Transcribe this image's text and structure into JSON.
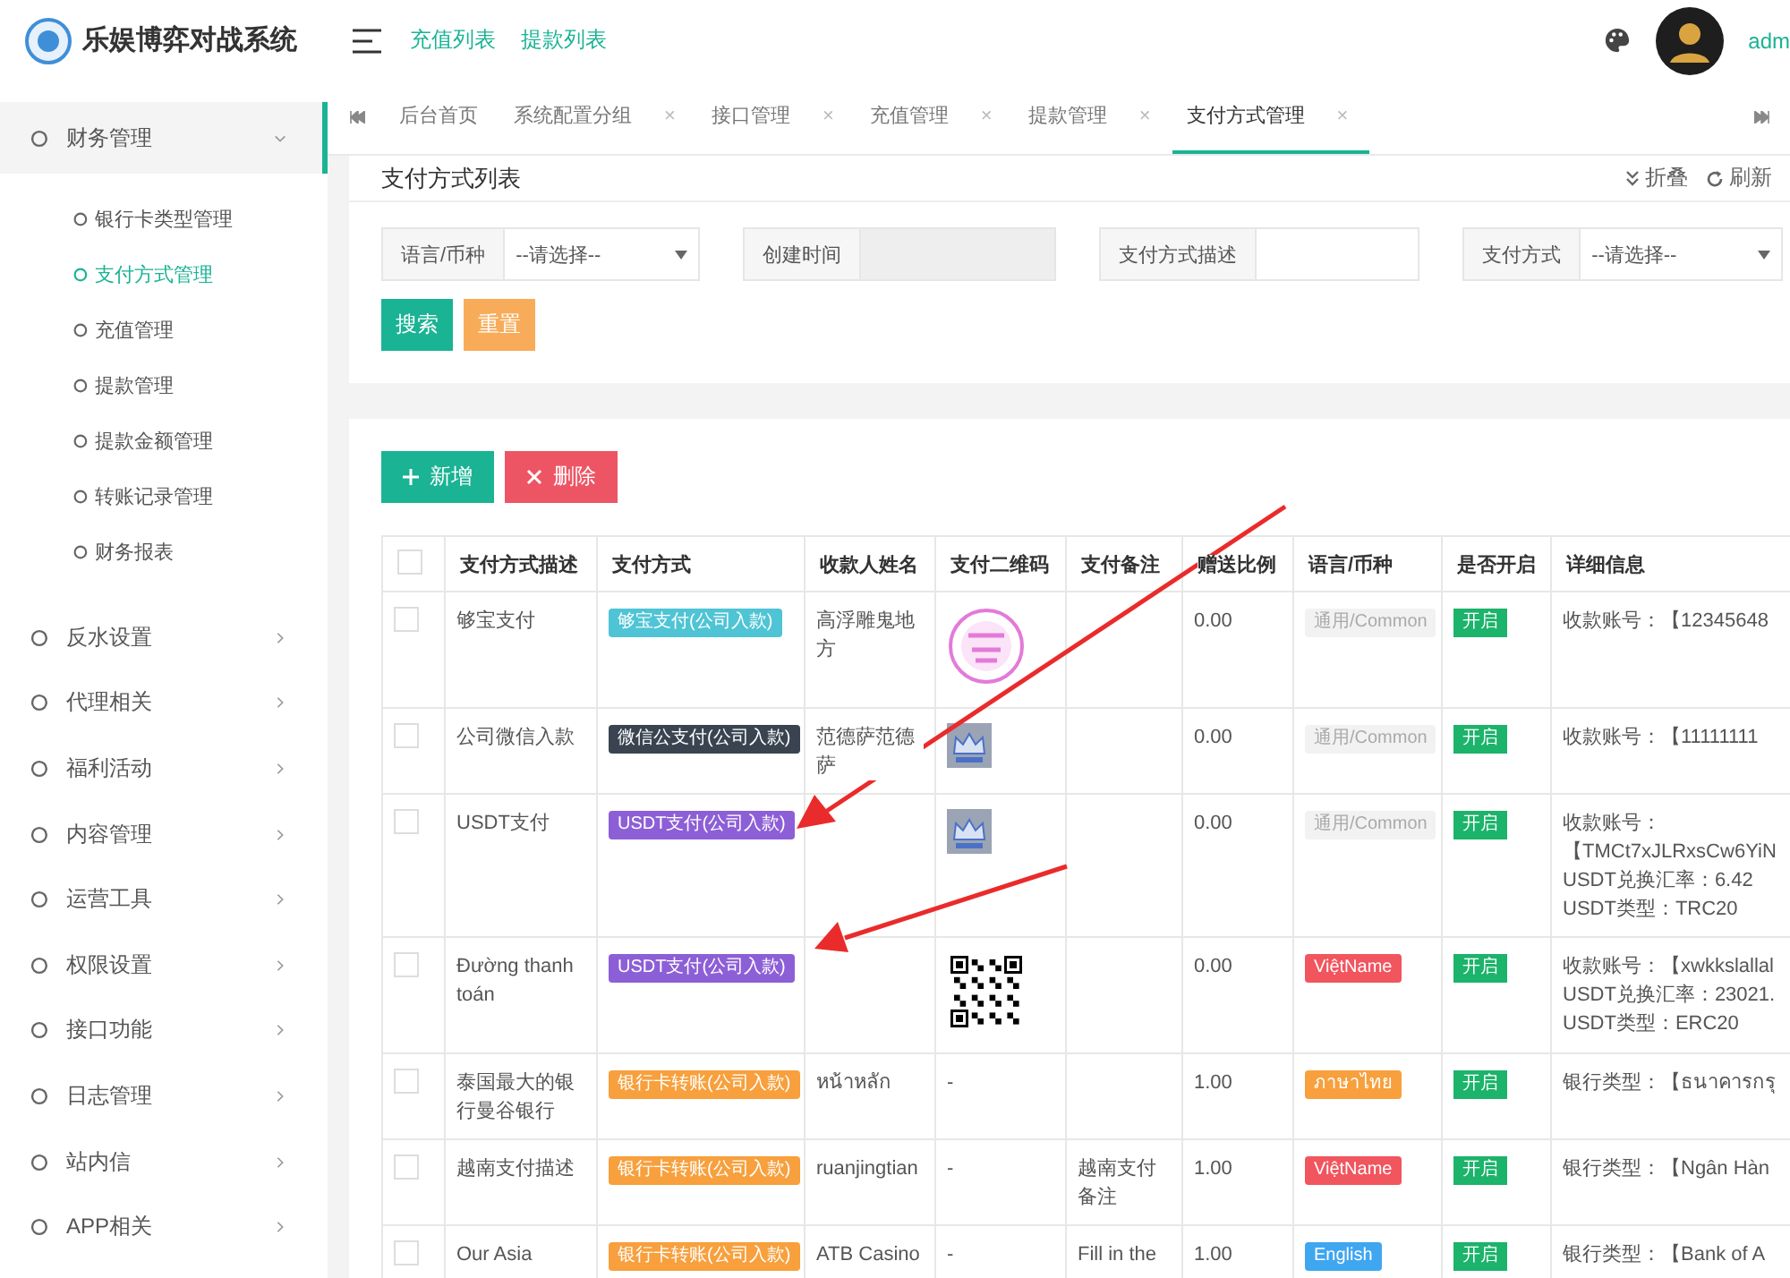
{
  "brand": {
    "title": "乐娱博弈对战系统"
  },
  "header": {
    "links": [
      "充值列表",
      "提款列表"
    ],
    "user": "adm"
  },
  "sidebar": {
    "items": [
      {
        "label": "财务管理",
        "expanded": true,
        "children": [
          {
            "label": "银行卡类型管理",
            "selected": false
          },
          {
            "label": "支付方式管理",
            "selected": true
          },
          {
            "label": "充值管理",
            "selected": false
          },
          {
            "label": "提款管理",
            "selected": false
          },
          {
            "label": "提款金额管理",
            "selected": false
          },
          {
            "label": "转账记录管理",
            "selected": false
          },
          {
            "label": "财务报表",
            "selected": false
          }
        ]
      },
      {
        "label": "反水设置",
        "expanded": false
      },
      {
        "label": "代理相关",
        "expanded": false
      },
      {
        "label": "福利活动",
        "expanded": false
      },
      {
        "label": "内容管理",
        "expanded": false
      },
      {
        "label": "运营工具",
        "expanded": false
      },
      {
        "label": "权限设置",
        "expanded": false
      },
      {
        "label": "接口功能",
        "expanded": false
      },
      {
        "label": "日志管理",
        "expanded": false
      },
      {
        "label": "站内信",
        "expanded": false
      },
      {
        "label": "APP相关",
        "expanded": false
      }
    ]
  },
  "tabs": [
    {
      "label": "后台首页",
      "selected": false
    },
    {
      "label": "系统配置分组",
      "close": "×",
      "selected": false
    },
    {
      "label": "接口管理",
      "close": "×",
      "selected": false
    },
    {
      "label": "充值管理",
      "close": "×",
      "selected": false
    },
    {
      "label": "提款管理",
      "close": "×",
      "selected": false
    },
    {
      "label": "支付方式管理",
      "close": "×",
      "selected": true
    }
  ],
  "panel": {
    "title": "支付方式列表",
    "actions": [
      "折叠",
      "刷新"
    ]
  },
  "filters": [
    {
      "label": "语言/币种",
      "kind": "select",
      "value": "--请选择--"
    },
    {
      "label": "创建时间",
      "kind": "disabled"
    },
    {
      "label": "支付方式描述",
      "kind": "input"
    },
    {
      "label": "支付方式",
      "kind": "select",
      "value": "--请选择--"
    }
  ],
  "filter_buttons": [
    "搜索",
    "重置"
  ],
  "toolbar": [
    "新增",
    "删除"
  ],
  "table": {
    "select_all": {
      "checked": false
    },
    "columns": [
      "支付方式描述",
      "支付方式",
      "收款人姓名",
      "支付二维码",
      "支付备注",
      "赠送比例",
      "语言/币种",
      "是否开启",
      "详细信息"
    ],
    "rows": [
      {
        "checked": false,
        "description": "够宝支付",
        "method": {
          "text": "够宝支付(公司入款)",
          "color": "#4fc4d4"
        },
        "payee": "高浮雕鬼地方",
        "qr": {
          "kind": "stamp"
        },
        "note": "",
        "ratio": "0.00",
        "language": {
          "text": "通用/Common",
          "color": "#f2f2f2"
        },
        "status": {
          "text": "开启",
          "on": true
        },
        "details": [
          "收款账号：【12345648"
        ]
      },
      {
        "checked": false,
        "description": "公司微信入款",
        "method": {
          "text": "微信公支付(公司入款)",
          "color": "#3a4451"
        },
        "payee": "范德萨范德萨",
        "qr": {
          "kind": "crown"
        },
        "note": "",
        "ratio": "0.00",
        "language": {
          "text": "通用/Common",
          "color": "#f2f2f2"
        },
        "status": {
          "text": "开启",
          "on": true
        },
        "details": [
          "收款账号：【11111111"
        ]
      },
      {
        "checked": false,
        "description": "USDT支付",
        "method": {
          "text": "USDT支付(公司入款)",
          "color": "#8d5fd6"
        },
        "payee": "",
        "qr": {
          "kind": "crown"
        },
        "note": "",
        "ratio": "0.00",
        "language": {
          "text": "通用/Common",
          "color": "#f2f2f2"
        },
        "status": {
          "text": "开启",
          "on": true
        },
        "details": [
          "收款账号：",
          "【TMCt7xJLRxsCw6YiN",
          "USDT兑换汇率：6.42",
          "USDT类型：TRC20"
        ]
      },
      {
        "checked": false,
        "description": "Đường thanh toán",
        "method": {
          "text": "USDT支付(公司入款)",
          "color": "#8d5fd6"
        },
        "payee": "",
        "qr": {
          "kind": "qrcode"
        },
        "note": "",
        "ratio": "0.00",
        "language": {
          "text": "ViệtName",
          "color": "#f1555e"
        },
        "status": {
          "text": "开启",
          "on": true
        },
        "details": [
          "收款账号：【xwkkslallal",
          "USDT兑换汇率：23021.",
          "USDT类型：ERC20"
        ]
      },
      {
        "checked": false,
        "description": "泰国最大的银行曼谷银行",
        "method": {
          "text": "银行卡转账(公司入款)",
          "color": "#f7a03d"
        },
        "payee": "หน้าหลัก",
        "qr": {
          "kind": "text",
          "text": "-"
        },
        "note": "",
        "ratio": "1.00",
        "language": {
          "text": "ภาษาไทย",
          "color": "#f7a03d"
        },
        "status": {
          "text": "开启",
          "on": true
        },
        "details": [
          "银行类型：【ธนาคารกรุ"
        ]
      },
      {
        "checked": false,
        "description": "越南支付描述",
        "method": {
          "text": "银行卡转账(公司入款)",
          "color": "#f7a03d"
        },
        "payee": "ruanjingtian",
        "qr": {
          "kind": "text",
          "text": "-"
        },
        "note": "越南支付备注",
        "ratio": "1.00",
        "language": {
          "text": "ViệtName",
          "color": "#f1555e"
        },
        "status": {
          "text": "开启",
          "on": true
        },
        "details": [
          "银行类型：【Ngân Hàn"
        ]
      },
      {
        "checked": false,
        "description": "Our Asia",
        "method": {
          "text": "银行卡转账(公司入款)",
          "color": "#f7a03d"
        },
        "payee": "ATB Casino",
        "qr": {
          "kind": "text",
          "text": "-"
        },
        "note": "Fill in the",
        "ratio": "1.00",
        "language": {
          "text": "English",
          "color": "#3fa6f0"
        },
        "status": {
          "text": "开启",
          "on": true
        },
        "details": [
          "银行类型：【Bank of A"
        ]
      }
    ]
  }
}
